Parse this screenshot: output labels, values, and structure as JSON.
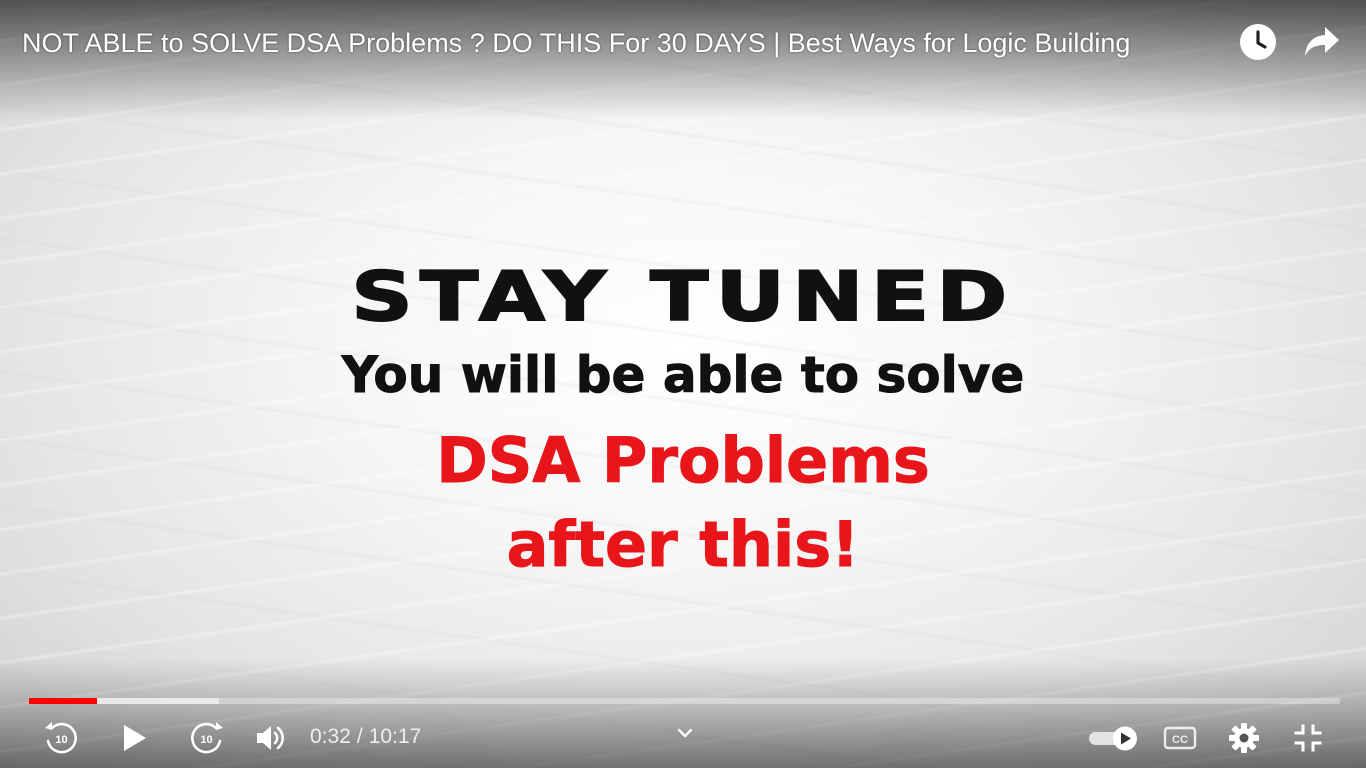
{
  "video": {
    "title": "NOT ABLE to SOLVE DSA Problems ? DO THIS For 30 DAYS | Best Ways for Logic Building",
    "overlay": {
      "headline": "STAY TUNED",
      "line2": "You will be able to solve",
      "line3": "DSA Problems",
      "line4": "after this!"
    }
  },
  "top_bar": {
    "watch_later_icon": "clock-icon",
    "share_icon": "share-arrow-icon"
  },
  "progress": {
    "current_seconds": 32,
    "duration_seconds": 617,
    "buffered_fraction": 0.145
  },
  "controls": {
    "current_time": "0:32",
    "separator": "/",
    "duration": "10:17",
    "rewind_seconds": "10",
    "forward_seconds": "10",
    "icons": {
      "rewind": "rewind-10-icon",
      "play": "play-icon",
      "forward": "forward-10-icon",
      "volume": "volume-icon",
      "chapters": "chevron-down-icon",
      "autoplay": "autoplay-toggle-icon",
      "captions": "cc-icon",
      "settings": "gear-icon",
      "exit_fullscreen": "exit-fullscreen-icon"
    }
  },
  "colors": {
    "accent": "#ff0000",
    "overlay_dark": "#111111",
    "overlay_red": "#e8161a"
  }
}
